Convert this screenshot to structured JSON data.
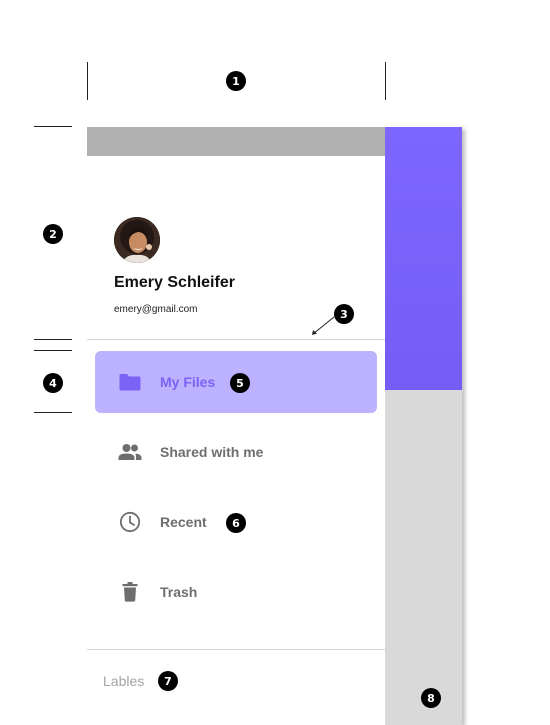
{
  "annotations": {
    "badge_1": "1",
    "badge_2": "2",
    "badge_3": "3",
    "badge_4": "4",
    "badge_5": "5",
    "badge_6": "6",
    "badge_7": "7",
    "badge_8": "8"
  },
  "colors": {
    "accent": "#7d66ff",
    "active_item_bg": "#bcb2ff",
    "active_item_text": "#7a63f5",
    "status_bar": "#b1b1b1",
    "scrim": "#d9d9d9"
  },
  "drawer": {
    "user": {
      "name": "Emery Schleifer",
      "email": "emery@gmail.com",
      "avatar": "avatar-photo"
    },
    "nav_items": [
      {
        "label": "My Files",
        "icon": "folder-icon",
        "active": true
      },
      {
        "label": "Shared with me",
        "icon": "people-icon",
        "active": false
      },
      {
        "label": "Recent",
        "icon": "clock-icon",
        "active": false
      },
      {
        "label": "Trash",
        "icon": "trash-icon",
        "active": false
      }
    ],
    "labels_heading": "Lables"
  }
}
